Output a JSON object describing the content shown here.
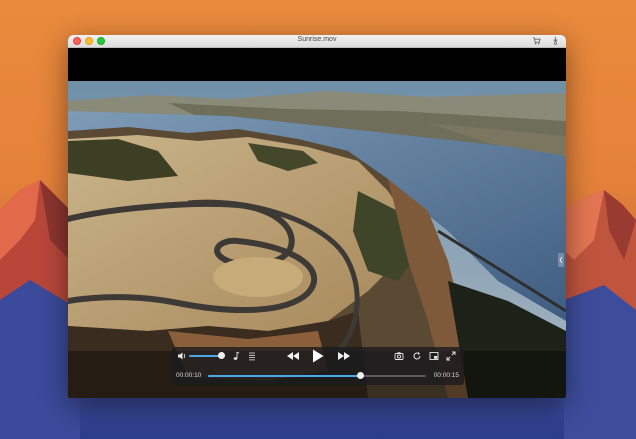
{
  "window": {
    "title": "Sunrise.mov",
    "toolbar_icons": [
      "cart-icon",
      "download-icon"
    ]
  },
  "player": {
    "current_time": "00:00:10",
    "duration": "00:00:15",
    "progress_fraction": 0.7,
    "volume_fraction": 0.9,
    "accent_color": "#4aa8e6",
    "controls": [
      "volume-icon",
      "music-note-icon",
      "playlist-icon",
      "rewind-icon",
      "play-icon",
      "fast-forward-icon",
      "screenshot-icon",
      "loop-icon",
      "picture-in-picture-icon",
      "fullscreen-icon"
    ]
  },
  "desktop": {
    "wallpaper_colors": [
      "#e98a3c",
      "#2c3d8c"
    ]
  }
}
